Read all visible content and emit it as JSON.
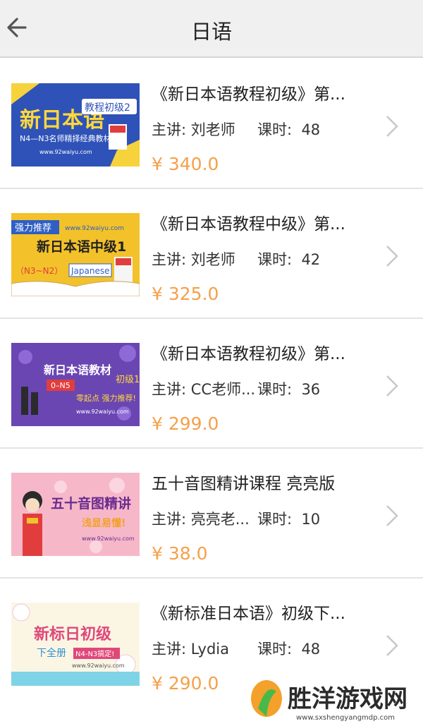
{
  "header": {
    "title": "日语",
    "back_icon": "arrow-left-icon"
  },
  "colors": {
    "price": "#f5a04a",
    "topbar": "#f0f0f0",
    "chevron": "#c8c8c8"
  },
  "courses": [
    {
      "title": "《新日本语教程初级》第...",
      "teacher_label": "主讲: 刘老师",
      "hours_label": "课时:",
      "hours": "48",
      "price": "¥ 340.0",
      "thumb": {
        "main": "新日本语",
        "tag": "教程初级2",
        "sub": "N4—N3名师精择经典教材",
        "url": "www.92waiyu.com"
      }
    },
    {
      "title": "《新日本语教程中级》第...",
      "teacher_label": "主讲: 刘老师",
      "hours_label": "课时:",
      "hours": "42",
      "price": "¥ 325.0",
      "thumb": {
        "badge": "强力推荐",
        "url": "www.92waiyu.com",
        "main": "新日本语中级1",
        "level": "（N3~N2）",
        "tag": "Japanese"
      }
    },
    {
      "title": "《新日本语教程初级》第...",
      "teacher_label": "主讲: CC老师...",
      "hours_label": "课时:",
      "hours": "36",
      "price": "¥ 299.0",
      "thumb": {
        "main": "新日本语教材",
        "tag": "初级1",
        "level": "0–N5",
        "sub": "零起点 强力推荐!",
        "url": "www.92waiyu.com"
      }
    },
    {
      "title": "五十音图精讲课程 亮亮版",
      "teacher_label": "主讲: 亮亮老...",
      "hours_label": "课时:",
      "hours": "10",
      "price": "¥ 38.0",
      "thumb": {
        "main": "五十音图精讲",
        "sub": "浅显易懂!",
        "url": "www.92waiyu.com"
      }
    },
    {
      "title": "《新标准日本语》初级下...",
      "teacher_label": "主讲: Lydia",
      "hours_label": "课时:",
      "hours": "48",
      "price": "¥ 290.0",
      "thumb": {
        "main": "新标日初级",
        "tag": "下全册",
        "level": "N4-N3搞定!",
        "url": "www.92waiyu.com"
      }
    }
  ],
  "watermark": {
    "text": "胜洋游戏网",
    "url": "www.sxshengyangmdp.com"
  }
}
